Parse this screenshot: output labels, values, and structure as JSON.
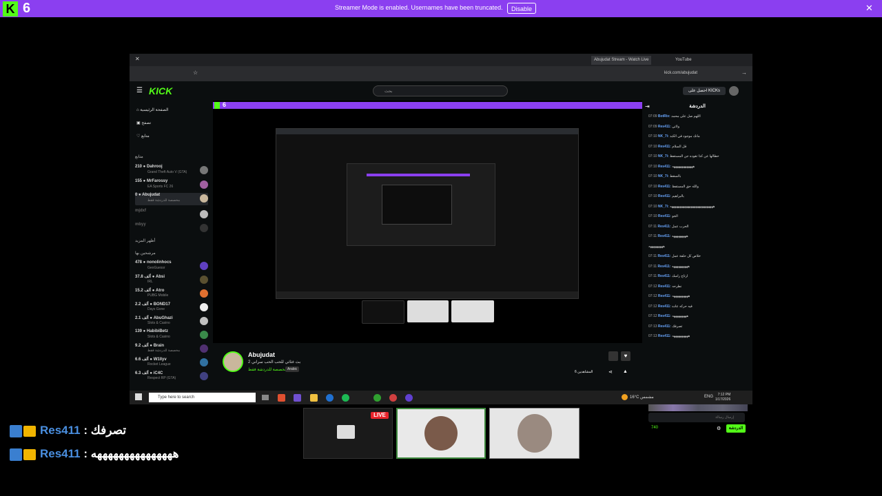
{
  "overlay": {
    "viewer_count": "6",
    "logo_letter": "K"
  },
  "banner": {
    "message": "Streamer Mode is enabled. Usernames have been truncated.",
    "disable_label": "Disable",
    "close_glyph": "✕"
  },
  "browser": {
    "tabs": [
      "Abujudat Stream - Watch Live",
      "YouTube"
    ],
    "url": "kick.com/abujudat"
  },
  "kick": {
    "logo": "KICK",
    "search_placeholder": "بحث",
    "get_kicks_label": "احصل على KICKs"
  },
  "sidebar": {
    "nav": [
      "الصفحة الرئيسية",
      "تصفح",
      "متابع"
    ],
    "following_header": "متابع",
    "following": [
      {
        "count": "210",
        "name": "Dahrooj",
        "game": "Grand Theft Auto V (GTA)"
      },
      {
        "count": "155",
        "name": "MrFarossy",
        "game": "EA Sports FC 26"
      },
      {
        "count": "0",
        "name": "Abujudat",
        "game": "مخصصة للدردشة فقط"
      },
      {
        "count": "",
        "name": "mjdxf",
        "game": ""
      },
      {
        "count": "",
        "name": "mbyy",
        "game": ""
      }
    ],
    "show_more": "أظهر المزيد",
    "recommended_header": "مرشحين بها",
    "recommended": [
      {
        "count": "478",
        "name": "nonolinhocs",
        "game": "GeoGuessr"
      },
      {
        "count": "37.8 ألف",
        "name": "Absi",
        "game": "IRL"
      },
      {
        "count": "15.2 ألف",
        "name": "Atro",
        "game": "PUBG Mobile"
      },
      {
        "count": "2.2 ألف",
        "name": "BOND17",
        "game": "Days Gone"
      },
      {
        "count": "2.1 ألف",
        "name": "AbuGhazi",
        "game": "Slots & Casino"
      },
      {
        "count": "139",
        "name": "HabibiBetz",
        "game": "Slots & Casino"
      },
      {
        "count": "9.2 ألف",
        "name": "Brain",
        "game": "مخصصة للدردشة فقط"
      },
      {
        "count": "6.6 ألف",
        "name": "W1llyv",
        "game": "Rocket League"
      },
      {
        "count": "6.3 ألف",
        "name": "iC4C",
        "game": "Respect RP (GTA)"
      }
    ]
  },
  "stream_info": {
    "name": "Abujudat",
    "title": "بث غثاثي للحب الحب سراني 2",
    "category": "مخصصة للدردشة فقط",
    "tag": "Arabic",
    "viewers_label": "6 المشاهدين"
  },
  "chat": {
    "header": "الدردشة",
    "messages": [
      {
        "time": "07:09",
        "user": "BotRix:",
        "text": "اللهم صل على محمد"
      },
      {
        "time": "07:09",
        "user": "Res411:",
        "text": "ولاتي"
      },
      {
        "time": "07:10",
        "user": "NK_7i:",
        "text": "مانك موجود في الكبد"
      },
      {
        "time": "07:10",
        "user": "Res411:",
        "text": "قل السلام"
      },
      {
        "time": "07:10",
        "user": "NK_7i:",
        "text": "حطالها عن كذا تقوده جن المستفظ"
      },
      {
        "time": "07:10",
        "user": "Res411:",
        "text": "هههههههههههههه"
      },
      {
        "time": "07:10",
        "user": "NK_7i:",
        "text": "بالسقط"
      },
      {
        "time": "07:10",
        "user": "Res411:",
        "text": "والله حق المستفظ"
      },
      {
        "time": "07:10",
        "user": "Res411:",
        "text": "بالبراهيم"
      },
      {
        "time": "07:10",
        "user": "NK_7i:",
        "text": "هههههههههههههههههههههههههههه"
      },
      {
        "time": "07:10",
        "user": "Res411:",
        "text": "الجو"
      },
      {
        "time": "07:11",
        "user": "Res411:",
        "text": "الحرب عمل"
      },
      {
        "time": "07:11",
        "user": "Res411:",
        "text": "هههههههههه"
      },
      {
        "time": "",
        "user": "",
        "text": "هههههههههه"
      },
      {
        "time": "07:11",
        "user": "Res411:",
        "text": "خلاص كل حلفة عمل"
      },
      {
        "time": "07:11",
        "user": "Res411:",
        "text": "ههههههههههه"
      },
      {
        "time": "07:11",
        "user": "Res411:",
        "text": "ارتاح راسك"
      },
      {
        "time": "07:12",
        "user": "Res411:",
        "text": "نطرحه"
      },
      {
        "time": "07:12",
        "user": "Res411:",
        "text": "ههههههههههه"
      },
      {
        "time": "07:12",
        "user": "Res411:",
        "text": "فيه حركه عاده"
      },
      {
        "time": "07:12",
        "user": "Res411:",
        "text": "هههههههههه"
      },
      {
        "time": "07:13",
        "user": "Res411:",
        "text": "تصرفك"
      },
      {
        "time": "07:13",
        "user": "Res411:",
        "text": "ههههههههههه"
      }
    ],
    "input_placeholder": "إرسال رسالة",
    "send_label": "الدردشة",
    "points": "740"
  },
  "taskbar": {
    "search_placeholder": "Type here to search",
    "weather": "16°C مشمس",
    "lang": "ENG",
    "time": "7:12 PM",
    "date": "1/17/2026"
  },
  "bottom": {
    "live_label": "LIVE"
  },
  "overlay_chat": [
    {
      "user": "Res411",
      "sep": ":",
      "text": "تصرفك"
    },
    {
      "user": "Res411",
      "sep": ":",
      "text": "هههههههههههههههه"
    }
  ],
  "colors": {
    "kick_green": "#53fc18",
    "banner_purple": "#8b3ff0",
    "live_red": "#e8232b",
    "username_blue": "#4a8fe0"
  }
}
